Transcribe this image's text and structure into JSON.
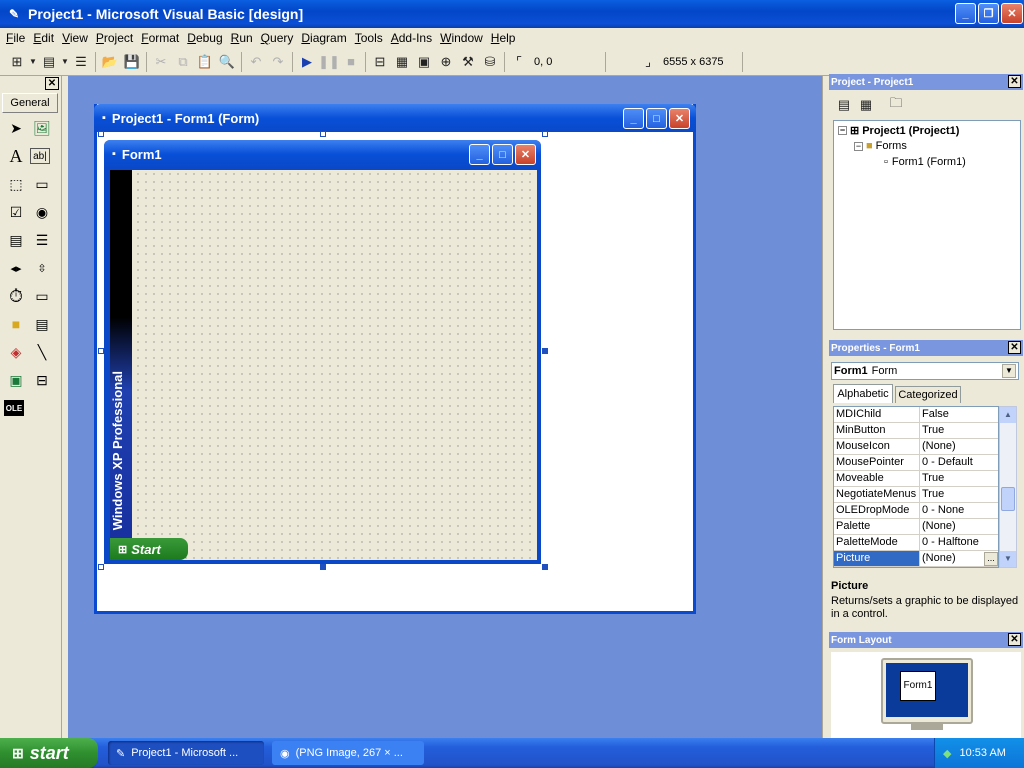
{
  "window": {
    "title": "Project1 - Microsoft Visual Basic [design]"
  },
  "menu": [
    "File",
    "Edit",
    "View",
    "Project",
    "Format",
    "Debug",
    "Run",
    "Query",
    "Diagram",
    "Tools",
    "Add-Ins",
    "Window",
    "Help"
  ],
  "toolbar": {
    "position": "0, 0",
    "size": "6555 x 6375"
  },
  "toolbox": {
    "tab": "General"
  },
  "design_window": {
    "title": "Project1 - Form1 (Form)"
  },
  "form": {
    "title": "Form1",
    "banner_text": "Windows XP  Professional",
    "start_label": "Start"
  },
  "project_panel": {
    "title": "Project - Project1",
    "tree": {
      "root": "Project1 (Project1)",
      "folder": "Forms",
      "item": "Form1 (Form1)"
    }
  },
  "properties_panel": {
    "title": "Properties - Form1",
    "object_name": "Form1",
    "object_type": "Form",
    "tabs": [
      "Alphabetic",
      "Categorized"
    ],
    "rows": [
      {
        "name": "MDIChild",
        "value": "False"
      },
      {
        "name": "MinButton",
        "value": "True"
      },
      {
        "name": "MouseIcon",
        "value": "(None)"
      },
      {
        "name": "MousePointer",
        "value": "0 - Default"
      },
      {
        "name": "Moveable",
        "value": "True"
      },
      {
        "name": "NegotiateMenus",
        "value": "True"
      },
      {
        "name": "OLEDropMode",
        "value": "0 - None"
      },
      {
        "name": "Palette",
        "value": "(None)"
      },
      {
        "name": "PaletteMode",
        "value": "0 - Halftone"
      },
      {
        "name": "Picture",
        "value": "(None)"
      }
    ],
    "desc_title": "Picture",
    "desc_text": "Returns/sets a graphic to be displayed in a control."
  },
  "layout_panel": {
    "title": "Form Layout",
    "preview_label": "Form1"
  },
  "taskbar": {
    "start": "start",
    "tasks": [
      "Project1 - Microsoft ...",
      "(PNG Image, 267 × ..."
    ],
    "clock": "10:53 AM"
  }
}
